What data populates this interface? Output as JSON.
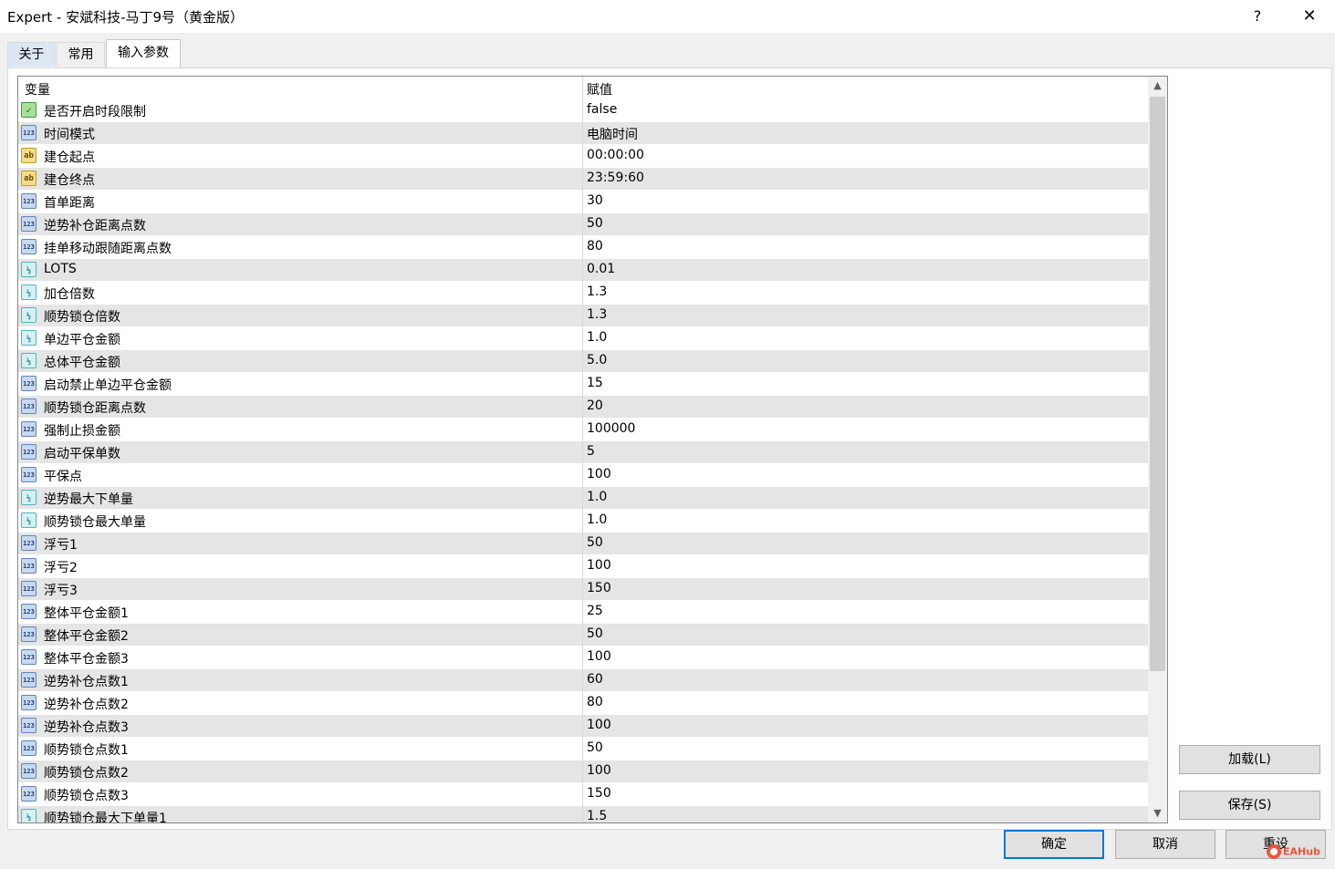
{
  "window": {
    "title": "Expert - 安斌科技-马丁9号（黄金版）",
    "help_label": "?",
    "close_label": "✕"
  },
  "tabs": [
    {
      "label": "关于"
    },
    {
      "label": "常用"
    },
    {
      "label": "输入参数",
      "active": true
    }
  ],
  "table": {
    "headers": {
      "variable": "变量",
      "value": "赋值"
    },
    "rows": [
      {
        "type": "bool",
        "name": "是否开启时段限制",
        "value": "false"
      },
      {
        "type": "int",
        "name": "时间模式",
        "value": "电脑时间"
      },
      {
        "type": "string",
        "name": "建仓起点",
        "value": "00:00:00"
      },
      {
        "type": "string",
        "name": "建仓终点",
        "value": "23:59:60"
      },
      {
        "type": "int",
        "name": "首单距离",
        "value": "30"
      },
      {
        "type": "int",
        "name": "逆势补仓距离点数",
        "value": "50"
      },
      {
        "type": "int",
        "name": "挂单移动跟随距离点数",
        "value": "80"
      },
      {
        "type": "double",
        "name": "LOTS",
        "value": "0.01"
      },
      {
        "type": "double",
        "name": "加仓倍数",
        "value": "1.3"
      },
      {
        "type": "double",
        "name": "顺势锁仓倍数",
        "value": "1.3"
      },
      {
        "type": "double",
        "name": "单边平仓金额",
        "value": "1.0"
      },
      {
        "type": "double",
        "name": "总体平仓金额",
        "value": "5.0"
      },
      {
        "type": "int",
        "name": "启动禁止单边平仓金额",
        "value": "15"
      },
      {
        "type": "int",
        "name": "顺势锁仓距离点数",
        "value": "20"
      },
      {
        "type": "int",
        "name": "强制止损金额",
        "value": "100000"
      },
      {
        "type": "int",
        "name": "启动平保单数",
        "value": "5"
      },
      {
        "type": "int",
        "name": "平保点",
        "value": "100"
      },
      {
        "type": "double",
        "name": "逆势最大下单量",
        "value": "1.0"
      },
      {
        "type": "double",
        "name": "顺势锁仓最大单量",
        "value": "1.0"
      },
      {
        "type": "int",
        "name": "浮亏1",
        "value": "50"
      },
      {
        "type": "int",
        "name": "浮亏2",
        "value": "100"
      },
      {
        "type": "int",
        "name": "浮亏3",
        "value": "150"
      },
      {
        "type": "int",
        "name": "整体平仓金额1",
        "value": "25"
      },
      {
        "type": "int",
        "name": "整体平仓金额2",
        "value": "50"
      },
      {
        "type": "int",
        "name": "整体平仓金额3",
        "value": "100"
      },
      {
        "type": "int",
        "name": "逆势补仓点数1",
        "value": "60"
      },
      {
        "type": "int",
        "name": "逆势补仓点数2",
        "value": "80"
      },
      {
        "type": "int",
        "name": "逆势补仓点数3",
        "value": "100"
      },
      {
        "type": "int",
        "name": "顺势锁仓点数1",
        "value": "50"
      },
      {
        "type": "int",
        "name": "顺势锁仓点数2",
        "value": "100"
      },
      {
        "type": "int",
        "name": "顺势锁仓点数3",
        "value": "150"
      },
      {
        "type": "double",
        "name": "顺势锁仓最大下单量1",
        "value": "1.5"
      }
    ]
  },
  "icons": {
    "int": "123",
    "double": "½",
    "string": "ab",
    "bool": "✓"
  },
  "scrollbar": {
    "up": "▲",
    "down": "▼"
  },
  "buttons": {
    "load": "加载(L)",
    "save": "保存(S)",
    "ok": "确定",
    "cancel": "取消",
    "reset": "重设"
  },
  "watermark": {
    "text": "EAHub"
  },
  "colors": {
    "alt_row": "#e5e5e5",
    "focus_border": "#0078d7",
    "watermark": "#e8573c"
  }
}
